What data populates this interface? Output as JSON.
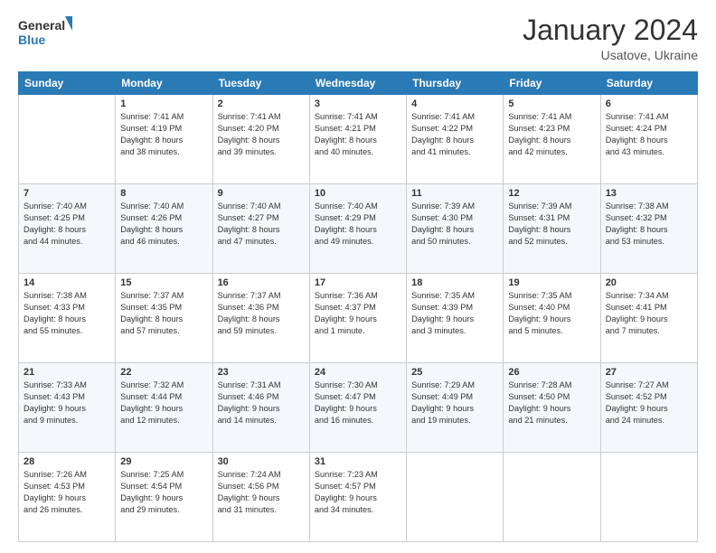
{
  "logo": {
    "line1": "General",
    "line2": "Blue"
  },
  "title": "January 2024",
  "subtitle": "Usatove, Ukraine",
  "days_header": [
    "Sunday",
    "Monday",
    "Tuesday",
    "Wednesday",
    "Thursday",
    "Friday",
    "Saturday"
  ],
  "weeks": [
    [
      {
        "day": "",
        "info": ""
      },
      {
        "day": "1",
        "info": "Sunrise: 7:41 AM\nSunset: 4:19 PM\nDaylight: 8 hours\nand 38 minutes."
      },
      {
        "day": "2",
        "info": "Sunrise: 7:41 AM\nSunset: 4:20 PM\nDaylight: 8 hours\nand 39 minutes."
      },
      {
        "day": "3",
        "info": "Sunrise: 7:41 AM\nSunset: 4:21 PM\nDaylight: 8 hours\nand 40 minutes."
      },
      {
        "day": "4",
        "info": "Sunrise: 7:41 AM\nSunset: 4:22 PM\nDaylight: 8 hours\nand 41 minutes."
      },
      {
        "day": "5",
        "info": "Sunrise: 7:41 AM\nSunset: 4:23 PM\nDaylight: 8 hours\nand 42 minutes."
      },
      {
        "day": "6",
        "info": "Sunrise: 7:41 AM\nSunset: 4:24 PM\nDaylight: 8 hours\nand 43 minutes."
      }
    ],
    [
      {
        "day": "7",
        "info": "Sunrise: 7:40 AM\nSunset: 4:25 PM\nDaylight: 8 hours\nand 44 minutes."
      },
      {
        "day": "8",
        "info": "Sunrise: 7:40 AM\nSunset: 4:26 PM\nDaylight: 8 hours\nand 46 minutes."
      },
      {
        "day": "9",
        "info": "Sunrise: 7:40 AM\nSunset: 4:27 PM\nDaylight: 8 hours\nand 47 minutes."
      },
      {
        "day": "10",
        "info": "Sunrise: 7:40 AM\nSunset: 4:29 PM\nDaylight: 8 hours\nand 49 minutes."
      },
      {
        "day": "11",
        "info": "Sunrise: 7:39 AM\nSunset: 4:30 PM\nDaylight: 8 hours\nand 50 minutes."
      },
      {
        "day": "12",
        "info": "Sunrise: 7:39 AM\nSunset: 4:31 PM\nDaylight: 8 hours\nand 52 minutes."
      },
      {
        "day": "13",
        "info": "Sunrise: 7:38 AM\nSunset: 4:32 PM\nDaylight: 8 hours\nand 53 minutes."
      }
    ],
    [
      {
        "day": "14",
        "info": "Sunrise: 7:38 AM\nSunset: 4:33 PM\nDaylight: 8 hours\nand 55 minutes."
      },
      {
        "day": "15",
        "info": "Sunrise: 7:37 AM\nSunset: 4:35 PM\nDaylight: 8 hours\nand 57 minutes."
      },
      {
        "day": "16",
        "info": "Sunrise: 7:37 AM\nSunset: 4:36 PM\nDaylight: 8 hours\nand 59 minutes."
      },
      {
        "day": "17",
        "info": "Sunrise: 7:36 AM\nSunset: 4:37 PM\nDaylight: 9 hours\nand 1 minute."
      },
      {
        "day": "18",
        "info": "Sunrise: 7:35 AM\nSunset: 4:39 PM\nDaylight: 9 hours\nand 3 minutes."
      },
      {
        "day": "19",
        "info": "Sunrise: 7:35 AM\nSunset: 4:40 PM\nDaylight: 9 hours\nand 5 minutes."
      },
      {
        "day": "20",
        "info": "Sunrise: 7:34 AM\nSunset: 4:41 PM\nDaylight: 9 hours\nand 7 minutes."
      }
    ],
    [
      {
        "day": "21",
        "info": "Sunrise: 7:33 AM\nSunset: 4:43 PM\nDaylight: 9 hours\nand 9 minutes."
      },
      {
        "day": "22",
        "info": "Sunrise: 7:32 AM\nSunset: 4:44 PM\nDaylight: 9 hours\nand 12 minutes."
      },
      {
        "day": "23",
        "info": "Sunrise: 7:31 AM\nSunset: 4:46 PM\nDaylight: 9 hours\nand 14 minutes."
      },
      {
        "day": "24",
        "info": "Sunrise: 7:30 AM\nSunset: 4:47 PM\nDaylight: 9 hours\nand 16 minutes."
      },
      {
        "day": "25",
        "info": "Sunrise: 7:29 AM\nSunset: 4:49 PM\nDaylight: 9 hours\nand 19 minutes."
      },
      {
        "day": "26",
        "info": "Sunrise: 7:28 AM\nSunset: 4:50 PM\nDaylight: 9 hours\nand 21 minutes."
      },
      {
        "day": "27",
        "info": "Sunrise: 7:27 AM\nSunset: 4:52 PM\nDaylight: 9 hours\nand 24 minutes."
      }
    ],
    [
      {
        "day": "28",
        "info": "Sunrise: 7:26 AM\nSunset: 4:53 PM\nDaylight: 9 hours\nand 26 minutes."
      },
      {
        "day": "29",
        "info": "Sunrise: 7:25 AM\nSunset: 4:54 PM\nDaylight: 9 hours\nand 29 minutes."
      },
      {
        "day": "30",
        "info": "Sunrise: 7:24 AM\nSunset: 4:56 PM\nDaylight: 9 hours\nand 31 minutes."
      },
      {
        "day": "31",
        "info": "Sunrise: 7:23 AM\nSunset: 4:57 PM\nDaylight: 9 hours\nand 34 minutes."
      },
      {
        "day": "",
        "info": ""
      },
      {
        "day": "",
        "info": ""
      },
      {
        "day": "",
        "info": ""
      }
    ]
  ]
}
